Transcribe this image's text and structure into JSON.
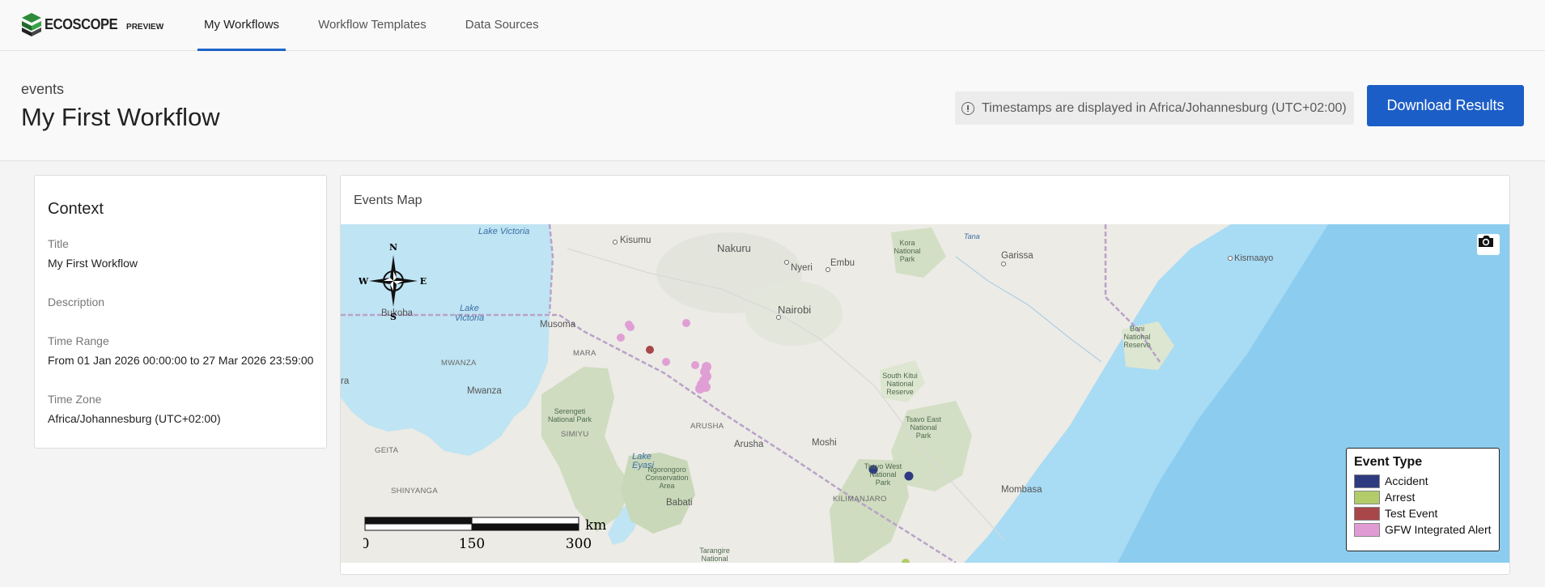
{
  "app": {
    "logo_text": "ECOSCOPE",
    "logo_sub": "PREVIEW",
    "nav": [
      {
        "label": "My Workflows",
        "active": true
      },
      {
        "label": "Workflow Templates",
        "active": false
      },
      {
        "label": "Data Sources",
        "active": false
      }
    ]
  },
  "header": {
    "subtitle": "events",
    "title": "My First Workflow",
    "timezone_note": "Timestamps are displayed in Africa/Johannesburg (UTC+02:00)",
    "download_label": "Download Results"
  },
  "context": {
    "heading": "Context",
    "fields": [
      {
        "label": "Title",
        "value": "My First Workflow"
      },
      {
        "label": "Description",
        "value": ""
      },
      {
        "label": "Time Range",
        "value": "From 01 Jan 2026 00:00:00 to 27 Mar 2026 23:59:00"
      },
      {
        "label": "Time Zone",
        "value": "Africa/Johannesburg (UTC+02:00)"
      }
    ]
  },
  "map": {
    "title": "Events Map",
    "compass": {
      "n": "N",
      "s": "S",
      "e": "E",
      "w": "W"
    },
    "scale": {
      "unit": "km",
      "ticks": [
        "0",
        "150",
        "300"
      ]
    },
    "legend": {
      "title": "Event Type",
      "items": [
        {
          "label": "Accident",
          "color": "#2e3a80"
        },
        {
          "label": "Arrest",
          "color": "#b2cc6a"
        },
        {
          "label": "Test Event",
          "color": "#a8464a"
        },
        {
          "label": "GFW Integrated Alert",
          "color": "#e09bd4"
        }
      ]
    },
    "places": {
      "lake_victoria": "Lake Victoria",
      "lake_victoria_2": "Lake Victoria",
      "kisumu": "Kisumu",
      "nakuru": "Nakuru",
      "nyeri": "Nyeri",
      "embu": "Embu",
      "garissa": "Garissa",
      "kismaayo": "Kismaayo",
      "nairobi": "Nairobi",
      "musoma": "Musoma",
      "bukoba": "Bukoba",
      "mara": "MARA",
      "mwanza_region": "MWANZA",
      "mwanza": "Mwanza",
      "simiyu": "SIMIYU",
      "arusha_region": "ARUSHA",
      "arusha": "Arusha",
      "moshi": "Moshi",
      "geita": "GEITA",
      "shinyanga": "SHINYANGA",
      "kilimanjaro": "KILIMANJARO",
      "mombasa": "Mombasa",
      "babati": "Babati",
      "lake_eyasi": "Lake Eyasi",
      "tana": "Tana",
      "ra": "ra",
      "kora": "Kora National Park",
      "boni": "Boni National Reserve",
      "south_kitui": "South Kitui National Reserve",
      "tsavo_east": "Tsavo East National Park",
      "tsavo_west": "Tsavo West National Park",
      "serengeti": "Serengeti National Park",
      "ngorongoro": "Ngorongoro Conservation Area",
      "tarangire": "Tarangire National"
    }
  }
}
